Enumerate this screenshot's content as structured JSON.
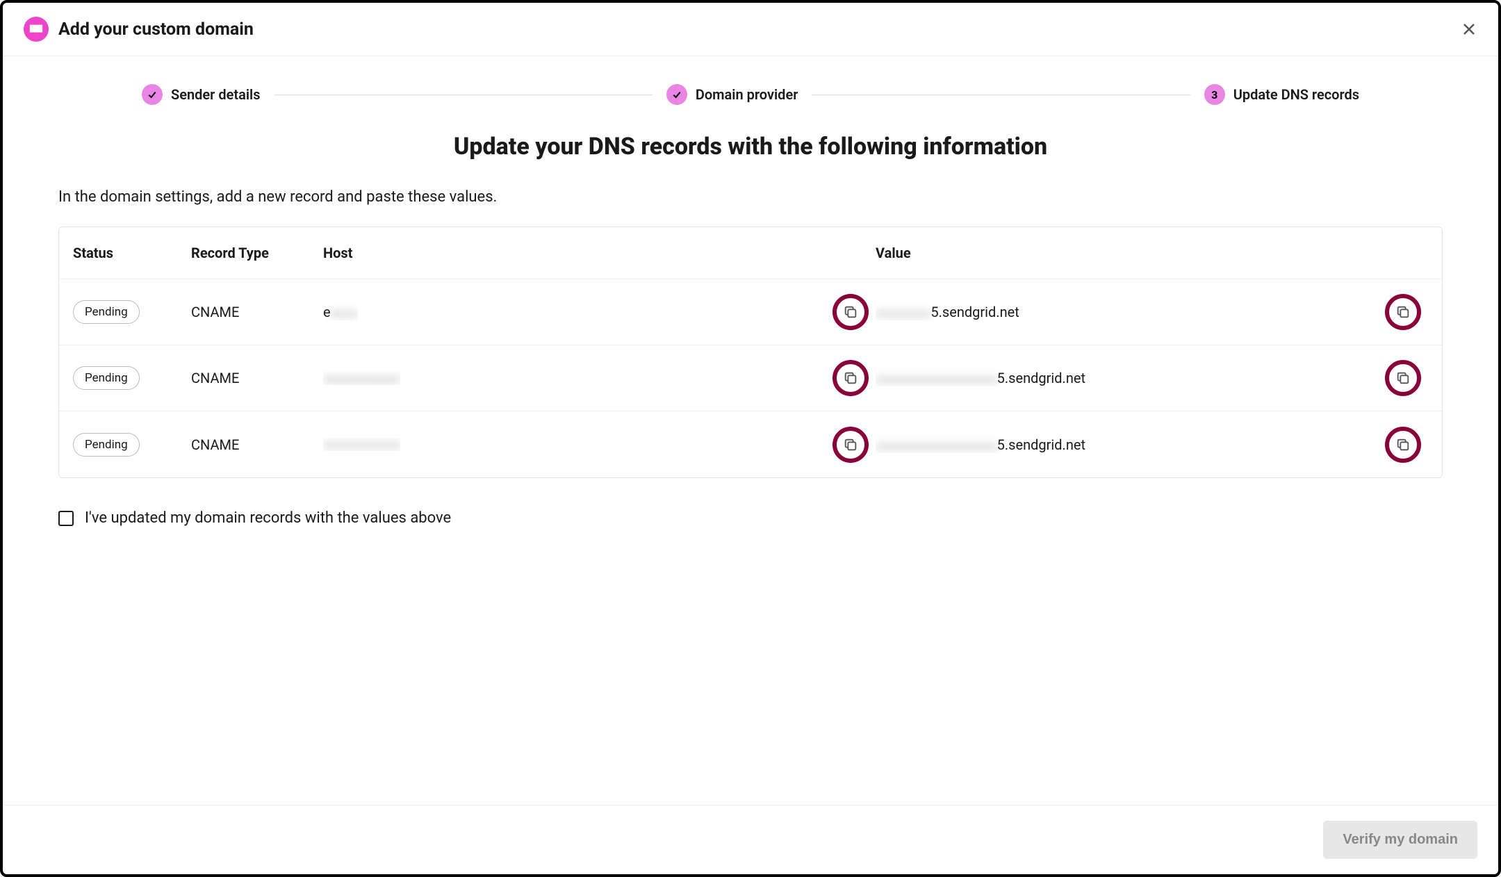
{
  "header": {
    "title": "Add your custom domain"
  },
  "stepper": {
    "steps": [
      {
        "label": "Sender details",
        "state": "done"
      },
      {
        "label": "Domain provider",
        "state": "done"
      },
      {
        "label": "Update DNS records",
        "state": "current",
        "number": "3"
      }
    ]
  },
  "page": {
    "heading": "Update your DNS records with the following information",
    "sub": "In the domain settings, add a new record and paste these values."
  },
  "table": {
    "columns": {
      "status": "Status",
      "record_type": "Record Type",
      "host": "Host",
      "value": "Value"
    },
    "rows": [
      {
        "status": "Pending",
        "record_type": "CNAME",
        "host_visible_prefix": "e",
        "host_obscured": "xxxxx",
        "value_obscured": "xxxxxxxxxx",
        "value_visible_suffix": "5.sendgrid.net"
      },
      {
        "status": "Pending",
        "record_type": "CNAME",
        "host_visible_prefix": "",
        "host_obscured": "xxxxxxxxxxxxxx",
        "value_obscured": "xxxxxxxxxxxxxxxxxxxxxx",
        "value_visible_suffix": "5.sendgrid.net"
      },
      {
        "status": "Pending",
        "record_type": "CNAME",
        "host_visible_prefix": "",
        "host_obscured": "xxxxxxxxxxxxxx",
        "value_obscured": "xxxxxxxxxxxxxxxxxxxxxx",
        "value_visible_suffix": "5.sendgrid.net"
      }
    ]
  },
  "confirm": {
    "label": "I've updated my domain records with the values above",
    "checked": false
  },
  "footer": {
    "verify_label": "Verify my domain"
  }
}
